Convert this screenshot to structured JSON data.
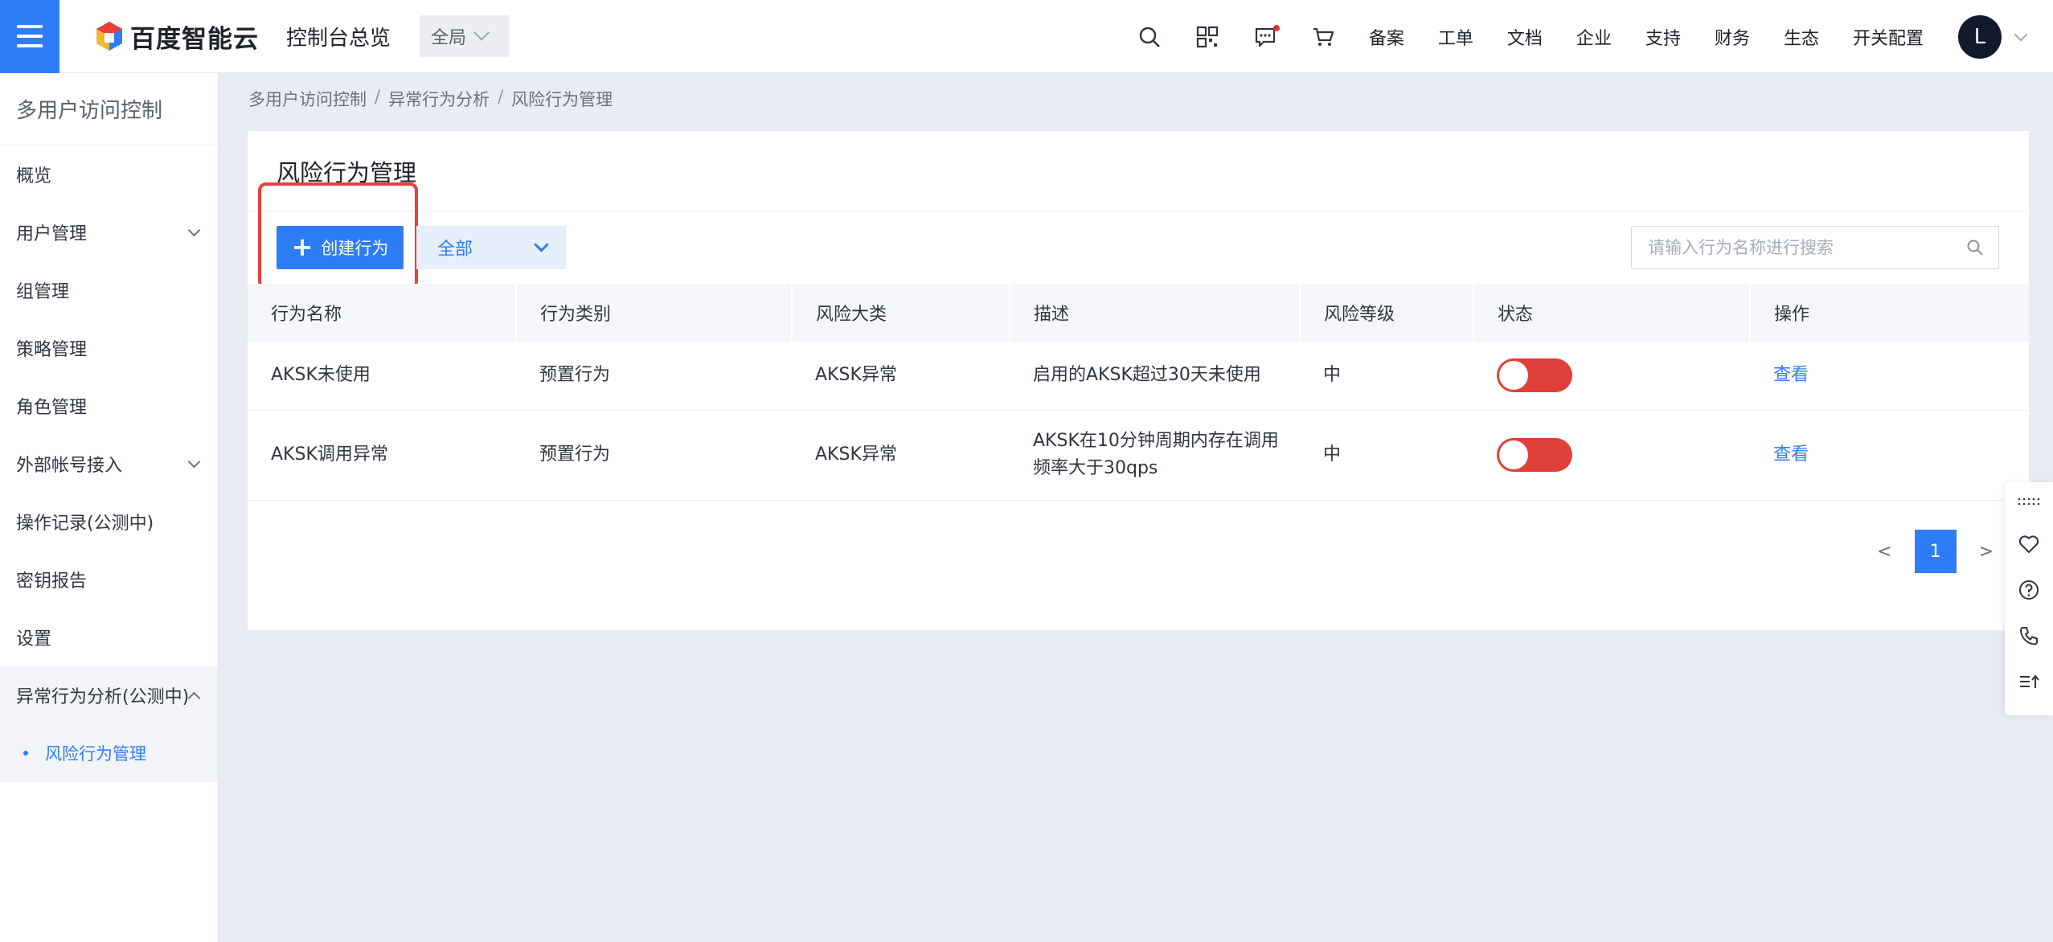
{
  "topbar": {
    "logo_text": "百度智能云",
    "console_title": "控制台总览",
    "region": "全局",
    "links": [
      "备案",
      "工单",
      "文档",
      "企业",
      "支持",
      "财务",
      "生态",
      "开关配置"
    ],
    "avatar_letter": "L"
  },
  "sidebar": {
    "title": "多用户访问控制",
    "items": [
      {
        "label": "概览"
      },
      {
        "label": "用户管理"
      },
      {
        "label": "组管理"
      },
      {
        "label": "策略管理"
      },
      {
        "label": "角色管理"
      },
      {
        "label": "外部帐号接入"
      },
      {
        "label": "操作记录(公测中)"
      },
      {
        "label": "密钥报告"
      },
      {
        "label": "设置"
      },
      {
        "label": "异常行为分析(公测中)"
      }
    ],
    "sub_active": "风险行为管理"
  },
  "breadcrumb": [
    "多用户访问控制",
    "异常行为分析",
    "风险行为管理"
  ],
  "main": {
    "title": "风险行为管理",
    "create_button": "创建行为",
    "filter_value": "全部",
    "search_placeholder": "请输入行为名称进行搜索",
    "columns": [
      "行为名称",
      "行为类别",
      "风险大类",
      "描述",
      "风险等级",
      "状态",
      "操作"
    ],
    "rows": [
      {
        "name": "AKSK未使用",
        "category": "预置行为",
        "risk_class": "AKSK异常",
        "desc": "启用的AKSK超过30天未使用",
        "level": "中",
        "enabled": false,
        "action": "查看"
      },
      {
        "name": "AKSK调用异常",
        "category": "预置行为",
        "risk_class": "AKSK异常",
        "desc": "AKSK在10分钟周期内存在调用频率大于30qps",
        "level": "中",
        "enabled": false,
        "action": "查看"
      }
    ],
    "pager": {
      "prev": "<",
      "current": "1",
      "next": ">"
    }
  },
  "colors": {
    "accent": "#2f7df6",
    "toggle_off": "#e0403a",
    "highlight": "#e8403a"
  }
}
